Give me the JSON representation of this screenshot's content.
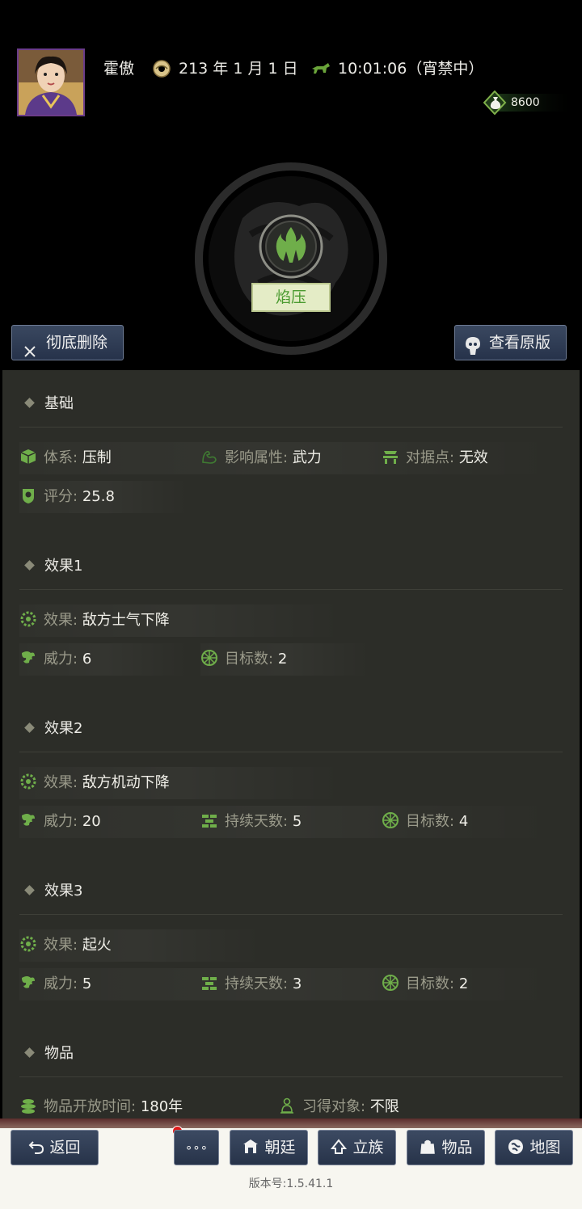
{
  "header": {
    "name": "霍傲",
    "date": "213 年 1 月 1 日",
    "time": "10:01:06（宵禁中）",
    "currency": "8600"
  },
  "skill": {
    "name": "焰压"
  },
  "actions": {
    "delete": "彻底删除",
    "view_original": "查看原版"
  },
  "sections": {
    "basic": {
      "title": "基础",
      "system_label": "体系:",
      "system_value": "压制",
      "attr_label": "影响属性:",
      "attr_value": "武力",
      "stronghold_label": "对据点:",
      "stronghold_value": "无效",
      "score_label": "评分:",
      "score_value": "25.8"
    },
    "effect1": {
      "title": "效果1",
      "effect_label": "效果:",
      "effect_value": "敌方士气下降",
      "power_label": "威力:",
      "power_value": "6",
      "targets_label": "目标数:",
      "targets_value": "2"
    },
    "effect2": {
      "title": "效果2",
      "effect_label": "效果:",
      "effect_value": "敌方机动下降",
      "power_label": "威力:",
      "power_value": "20",
      "days_label": "持续天数:",
      "days_value": "5",
      "targets_label": "目标数:",
      "targets_value": "4"
    },
    "effect3": {
      "title": "效果3",
      "effect_label": "效果:",
      "effect_value": "起火",
      "power_label": "威力:",
      "power_value": "5",
      "days_label": "持续天数:",
      "days_value": "3",
      "targets_label": "目标数:",
      "targets_value": "2"
    },
    "item": {
      "title": "物品",
      "open_label": "物品开放时间:",
      "open_value": "180年",
      "learn_label": "习得对象:",
      "learn_value": "不限"
    }
  },
  "nav": {
    "back": "返回",
    "more": "∘∘∘",
    "court": "朝廷",
    "clan": "立族",
    "items": "物品",
    "map": "地图"
  },
  "version": "版本号:1.5.41.1",
  "colors": {
    "accent_green": "#4a9a2f",
    "icon_green": "#6fae4a",
    "panel": "#2c2d28",
    "button_blue": "#2f3d55"
  },
  "icons": [
    "cube-icon",
    "muscle-icon",
    "fort-icon",
    "badge-icon",
    "gear-icon",
    "dragon-icon",
    "wall-icon",
    "target-icon",
    "stones-icon",
    "buddha-icon",
    "flame-icon",
    "coin-bag-icon",
    "jade-disc-icon",
    "horse-icon"
  ]
}
